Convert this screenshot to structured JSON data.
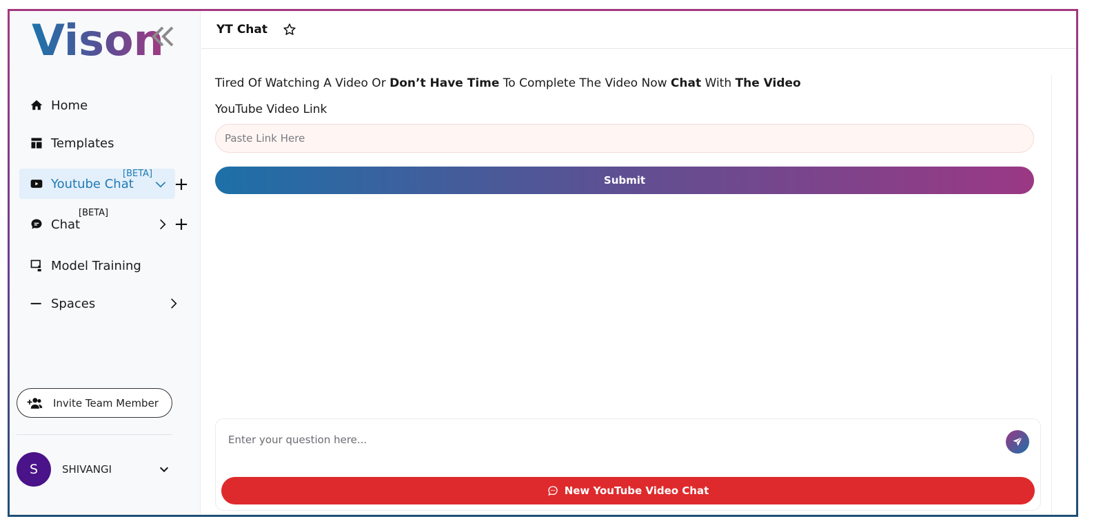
{
  "brand": {
    "logo_text": "Vison",
    "colors": {
      "primary": "#1f7ab3",
      "accent": "#9b3884",
      "danger": "#de2a2c",
      "avatar": "#4a1389"
    }
  },
  "sidebar": {
    "items": [
      {
        "label": "Home",
        "icon": "home-icon"
      },
      {
        "label": "Templates",
        "icon": "templates-icon"
      },
      {
        "label": "Youtube Chat",
        "icon": "youtube-icon",
        "badge": "[BETA]",
        "active": true,
        "expanded": true
      },
      {
        "label": "Chat",
        "icon": "chat-bubble-icon",
        "badge": "[BETA]",
        "expanded": false
      },
      {
        "label": "Model Training",
        "icon": "presentation-icon"
      },
      {
        "label": "Spaces",
        "icon": "minus-icon",
        "expanded": false
      }
    ],
    "invite_label": "Invite Team Member",
    "user": {
      "initial": "S",
      "name": "SHIVANGI"
    }
  },
  "header": {
    "title": "YT Chat"
  },
  "main": {
    "intro": [
      {
        "text": "Tired Of Watching A Video Or ",
        "bold": false
      },
      {
        "text": "Don’t Have Time",
        "bold": true
      },
      {
        "text": " To Complete The Video Now ",
        "bold": false
      },
      {
        "text": "Chat",
        "bold": true
      },
      {
        "text": " With ",
        "bold": false
      },
      {
        "text": "The Video",
        "bold": true
      }
    ],
    "link_label": "YouTube Video Link",
    "link_placeholder": "Paste Link Here",
    "submit_label": "Submit",
    "question_placeholder": "Enter your question here...",
    "new_chat_label": "New YouTube Video Chat"
  }
}
